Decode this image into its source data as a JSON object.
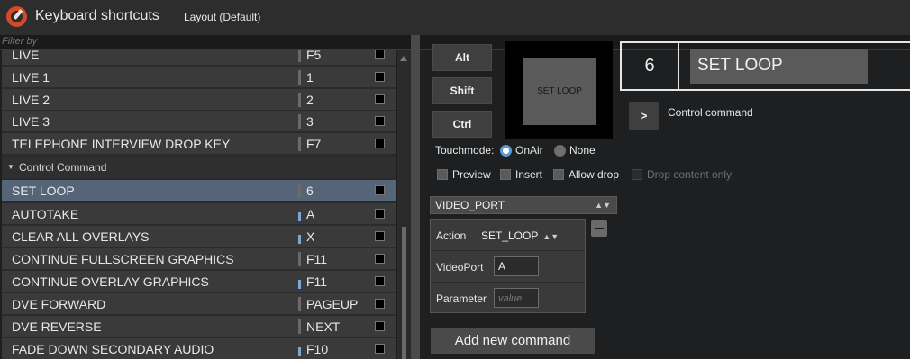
{
  "window": {
    "title": "Keyboard shortcuts",
    "layout_label": "Layout (Default)"
  },
  "filter": {
    "placeholder": "Filter by"
  },
  "list": {
    "rows_top": [
      {
        "name": "LIVE",
        "key": "F5"
      },
      {
        "name": "LIVE 1",
        "key": "1"
      },
      {
        "name": "LIVE 2",
        "key": "2"
      },
      {
        "name": "LIVE 3",
        "key": "3"
      },
      {
        "name": "TELEPHONE INTERVIEW DROP KEY",
        "key": "F7"
      }
    ],
    "group_label": "Control Command",
    "rows_group": [
      {
        "name": "SET LOOP",
        "key": "6"
      },
      {
        "name": "AUTOTAKE",
        "key": "A"
      },
      {
        "name": "CLEAR ALL OVERLAYS",
        "key": "X"
      },
      {
        "name": "CONTINUE FULLSCREEN GRAPHICS",
        "key": "F11"
      },
      {
        "name": "CONTINUE OVERLAY GRAPHICS",
        "key": "F11"
      },
      {
        "name": "DVE FORWARD",
        "key": "PAGEUP"
      },
      {
        "name": "DVE REVERSE",
        "key": "NEXT"
      },
      {
        "name": "FADE DOWN SECONDARY AUDIO",
        "key": "F10"
      }
    ]
  },
  "modifiers": {
    "alt": "Alt",
    "shift": "Shift",
    "ctrl": "Ctrl"
  },
  "preview": {
    "label": "SET LOOP"
  },
  "keybox": {
    "key": "6",
    "command": "SET LOOP"
  },
  "command_type": {
    "arrow": ">",
    "label": "Control command"
  },
  "touchmode": {
    "label": "Touchmode:",
    "on_air": "OnAir",
    "none": "None"
  },
  "options": {
    "preview": "Preview",
    "insert": "Insert",
    "allow_drop": "Allow drop",
    "drop_content_only": "Drop content only"
  },
  "port_select": {
    "value": "VIDEO_PORT"
  },
  "command_panel": {
    "action_label": "Action",
    "action_value": "SET_LOOP",
    "videoport_label": "VideoPort",
    "videoport_value": "A",
    "parameter_label": "Parameter",
    "parameter_placeholder": "value"
  },
  "add_button": "Add new command"
}
